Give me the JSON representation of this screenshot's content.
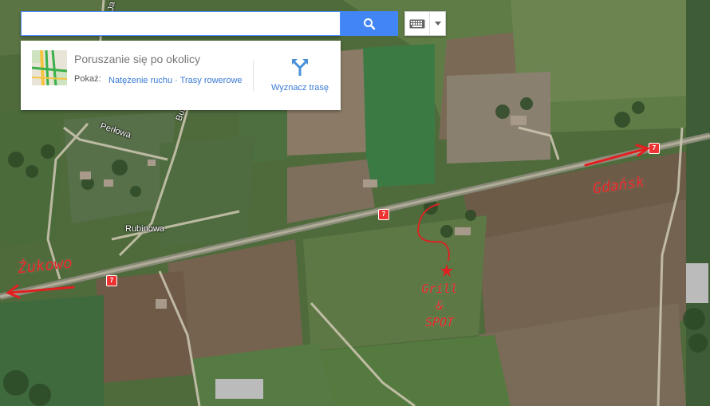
{
  "search": {
    "value": "",
    "placeholder": ""
  },
  "icons": {
    "search": "search-icon",
    "keyboard": "keyboard-icon",
    "dropdown": "chevron-down-icon",
    "traffic_thumb": "traffic-map-thumbnail",
    "directions": "directions-icon"
  },
  "colors": {
    "search_button": "#4285f4",
    "link": "#3a7bd5",
    "annotation_red": "#e02020",
    "road_shield": "#e33333"
  },
  "explore_card": {
    "title": "Poruszanie się po okolicy",
    "show_label": "Pokaż:",
    "traffic_link": "Natężenie ruchu",
    "separator": " · ",
    "bike_link": "Trasy rowerowe",
    "directions_label": "Wyznacz trasę"
  },
  "map": {
    "road_labels": [
      "Perłowa",
      "Burszty",
      "Rubinowa",
      "Ja"
    ],
    "route_shields": [
      "7",
      "7",
      "7"
    ],
    "annotations": {
      "left": "Żukowo",
      "right": "Gdańsk",
      "spot_lines": [
        "Grill",
        "&",
        "SPOT"
      ]
    }
  }
}
